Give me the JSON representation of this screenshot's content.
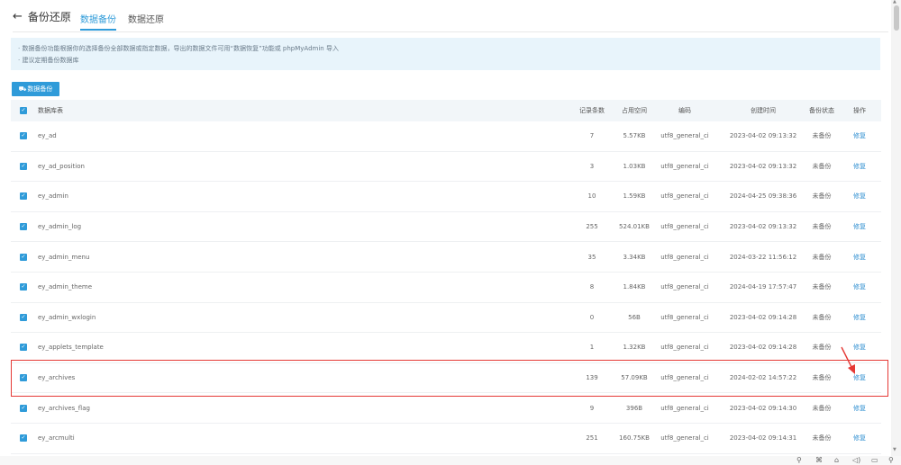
{
  "header": {
    "back_label": "备份还原",
    "tabs": [
      {
        "label": "数据备份",
        "active": true
      },
      {
        "label": "数据还原",
        "active": false
      }
    ]
  },
  "notice": {
    "lines": [
      "· 数据备份功能根据你的选择备份全部数据或指定数据，导出的数据文件可用“数据恢复”功能或 phpMyAdmin 导入",
      "· 建议定期备份数据库"
    ]
  },
  "toolbar": {
    "backup_label": "数据备份"
  },
  "table": {
    "columns": [
      "数据库表",
      "记录条数",
      "占用空间",
      "编码",
      "创建时间",
      "备份状态",
      "操作"
    ],
    "rows": [
      {
        "name": "ey_ad",
        "count": "7",
        "size": "5.57KB",
        "encoding": "utf8_general_ci",
        "created": "2023-04-02 09:13:32",
        "status": "未备份",
        "action": "修复"
      },
      {
        "name": "ey_ad_position",
        "count": "3",
        "size": "1.03KB",
        "encoding": "utf8_general_ci",
        "created": "2023-04-02 09:13:32",
        "status": "未备份",
        "action": "修复"
      },
      {
        "name": "ey_admin",
        "count": "10",
        "size": "1.59KB",
        "encoding": "utf8_general_ci",
        "created": "2024-04-25 09:38:36",
        "status": "未备份",
        "action": "修复"
      },
      {
        "name": "ey_admin_log",
        "count": "255",
        "size": "524.01KB",
        "encoding": "utf8_general_ci",
        "created": "2023-04-02 09:13:32",
        "status": "未备份",
        "action": "修复"
      },
      {
        "name": "ey_admin_menu",
        "count": "35",
        "size": "3.34KB",
        "encoding": "utf8_general_ci",
        "created": "2024-03-22 11:56:12",
        "status": "未备份",
        "action": "修复"
      },
      {
        "name": "ey_admin_theme",
        "count": "8",
        "size": "1.84KB",
        "encoding": "utf8_general_ci",
        "created": "2024-04-19 17:57:47",
        "status": "未备份",
        "action": "修复"
      },
      {
        "name": "ey_admin_wxlogin",
        "count": "0",
        "size": "56B",
        "encoding": "utf8_general_ci",
        "created": "2023-04-02 09:14:28",
        "status": "未备份",
        "action": "修复"
      },
      {
        "name": "ey_applets_template",
        "count": "1",
        "size": "1.32KB",
        "encoding": "utf8_general_ci",
        "created": "2023-04-02 09:14:28",
        "status": "未备份",
        "action": "修复"
      },
      {
        "name": "ey_archives",
        "count": "139",
        "size": "57.09KB",
        "encoding": "utf8_general_ci",
        "created": "2024-02-02 14:57:22",
        "status": "未备份",
        "action": "修复"
      },
      {
        "name": "ey_archives_flag",
        "count": "9",
        "size": "396B",
        "encoding": "utf8_general_ci",
        "created": "2023-04-02 09:14:30",
        "status": "未备份",
        "action": "修复"
      },
      {
        "name": "ey_arcmulti",
        "count": "251",
        "size": "160.75KB",
        "encoding": "utf8_general_ci",
        "created": "2023-04-02 09:14:31",
        "status": "未备份",
        "action": "修复"
      }
    ]
  },
  "icons": {
    "back": "arrow-left-icon",
    "backup": "database-icon",
    "checkbox": "checkmark-icon",
    "annotation": "red-arrow-icon",
    "taskbar": [
      "pin-icon",
      "link-icon",
      "trash-icon",
      "speaker-icon",
      "window-icon",
      "search-icon"
    ]
  },
  "colors": {
    "accent": "#2f9bd9",
    "notice_bg": "#e8f4fb",
    "highlight": "#e53935",
    "link": "#2f8fd1"
  }
}
